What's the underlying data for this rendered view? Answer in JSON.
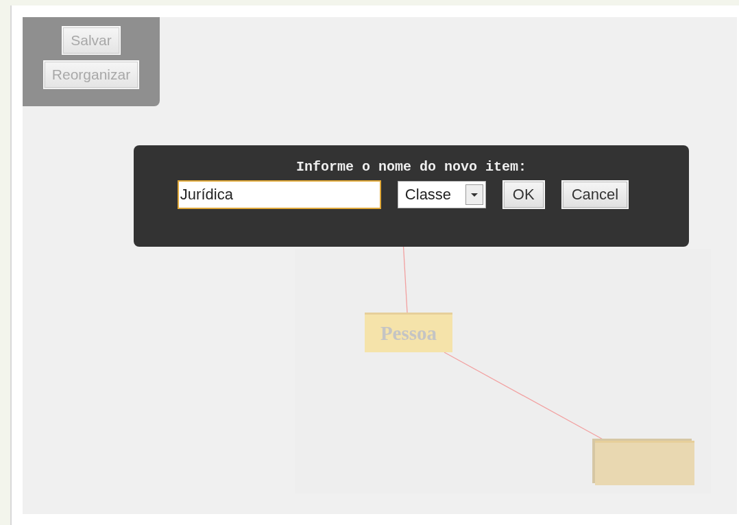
{
  "toolbar": {
    "buttons": [
      {
        "label": "Salvar",
        "disabled": true
      },
      {
        "label": "Reorganizar",
        "disabled": true
      }
    ]
  },
  "diagram": {
    "nodes": [
      {
        "kind": "labeled",
        "label": "Pessoa"
      },
      {
        "kind": "blank"
      }
    ]
  },
  "dialog": {
    "prompt": "Informe o nome do novo item:",
    "name_field": {
      "value": "Jurídica",
      "focused": true
    },
    "type_select": {
      "value": "Classe"
    },
    "buttons": [
      "OK",
      "Cancel"
    ]
  }
}
